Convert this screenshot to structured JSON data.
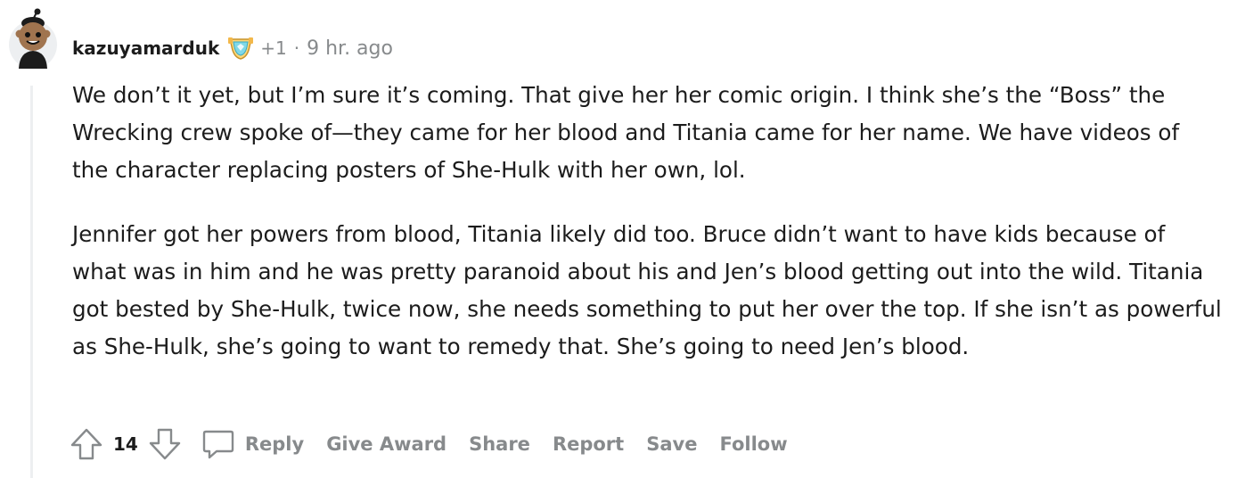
{
  "comment": {
    "author": "kazuyamarduk",
    "award_count": "+1",
    "separator": "·",
    "timestamp": "9 hr. ago",
    "paragraphs": [
      "We don’t it yet, but I’m sure it’s coming. That give her her comic origin. I think she’s the “Boss” the Wrecking crew spoke of—they came for her blood and Titania came for her name. We have videos of the character replacing posters of She-Hulk with her own, lol.",
      "Jennifer got her powers from blood, Titania likely did too. Bruce didn’t want to have kids because of what was in him and he was pretty paranoid about his and Jen’s blood getting out into the wild. Titania got bested by She-Hulk, twice now, she needs something to put her over the top. If she isn’t as powerful as She-Hulk, she’s going to want to remedy that. She’s going to need Jen’s blood."
    ],
    "score": "14",
    "actions": {
      "reply": "Reply",
      "give_award": "Give Award",
      "share": "Share",
      "report": "Report",
      "save": "Save",
      "follow": "Follow"
    }
  },
  "icons": {
    "avatar": "snoo-avatar-icon",
    "flair": "trophy-badge-icon",
    "upvote": "upvote-arrow-icon",
    "downvote": "downvote-arrow-icon",
    "reply": "speech-bubble-icon"
  },
  "colors": {
    "text_primary": "#1c1c1c",
    "text_muted": "#878a8c",
    "thread_line": "#edeff1"
  }
}
